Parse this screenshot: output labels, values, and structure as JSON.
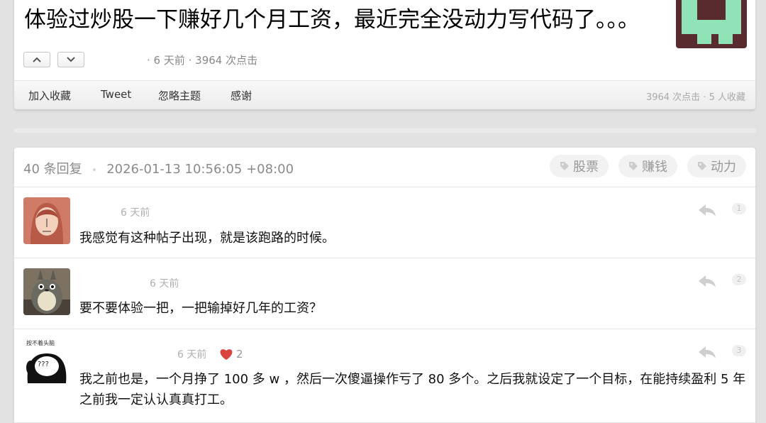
{
  "topic": {
    "title": "体验过炒股一下赚好几个月工资，最近完全没动力写代码了。。。",
    "meta": "· 6 天前 · 3964 次点击",
    "toolbar": {
      "favorite": "加入收藏",
      "tweet": "Tweet",
      "ignore": "忽略主题",
      "thanks": "感谢",
      "stats": "3964 次点击 · 5 人收藏"
    }
  },
  "replies_header": {
    "summary": "40 条回复",
    "separator": "•",
    "timestamp": "2026-01-13 10:56:05 +08:00",
    "tags": [
      "股票",
      "赚钱",
      "动力"
    ]
  },
  "replies": [
    {
      "time": "6 天前",
      "content": "我感觉有这种帖子出现，就是该跑路的时候。",
      "floor": "1",
      "likes": ""
    },
    {
      "time": "6 天前",
      "content": "要不要体验一把，一把输掉好几年的工资？",
      "floor": "2",
      "likes": ""
    },
    {
      "time": "6 天前",
      "content": "我之前也是，一个月挣了 100 多 w ，然后一次傻逼操作亏了 80 多个。之后我就设定了一个目标，在能持续盈利 5 年之前我一定认认真真打工。",
      "floor": "3",
      "likes": "2"
    }
  ],
  "avatar3_caption": "按不着头脑",
  "avatar3_text": "???",
  "colors": {
    "heart": "#e04848",
    "topic_avatar_bg": "#5a2b2e",
    "topic_avatar_fg": "#8fe3b7"
  },
  "icons": [
    "chevron-up-icon",
    "chevron-down-icon",
    "tag-icon",
    "reply-arrow-icon",
    "heart-icon"
  ]
}
